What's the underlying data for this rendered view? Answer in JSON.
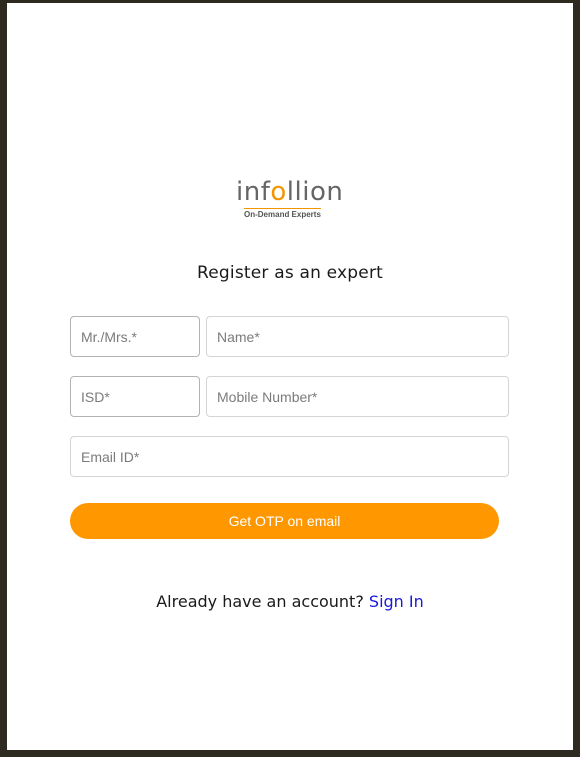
{
  "logo": {
    "word_start": "inf",
    "word_o": "o",
    "word_end": "llion",
    "tagline": "On-Demand Experts"
  },
  "heading": "Register as an expert",
  "form": {
    "title_placeholder": "Mr./Mrs.*",
    "name_placeholder": "Name*",
    "isd_placeholder": "ISD*",
    "mobile_placeholder": "Mobile Number*",
    "email_placeholder": "Email ID*",
    "submit_label": "Get OTP on email"
  },
  "footer": {
    "prompt": "Already have an account?",
    "link_label": "Sign In"
  },
  "colors": {
    "accent": "#ff9800",
    "link": "#1a1adb",
    "frame": "#2e2a20"
  }
}
